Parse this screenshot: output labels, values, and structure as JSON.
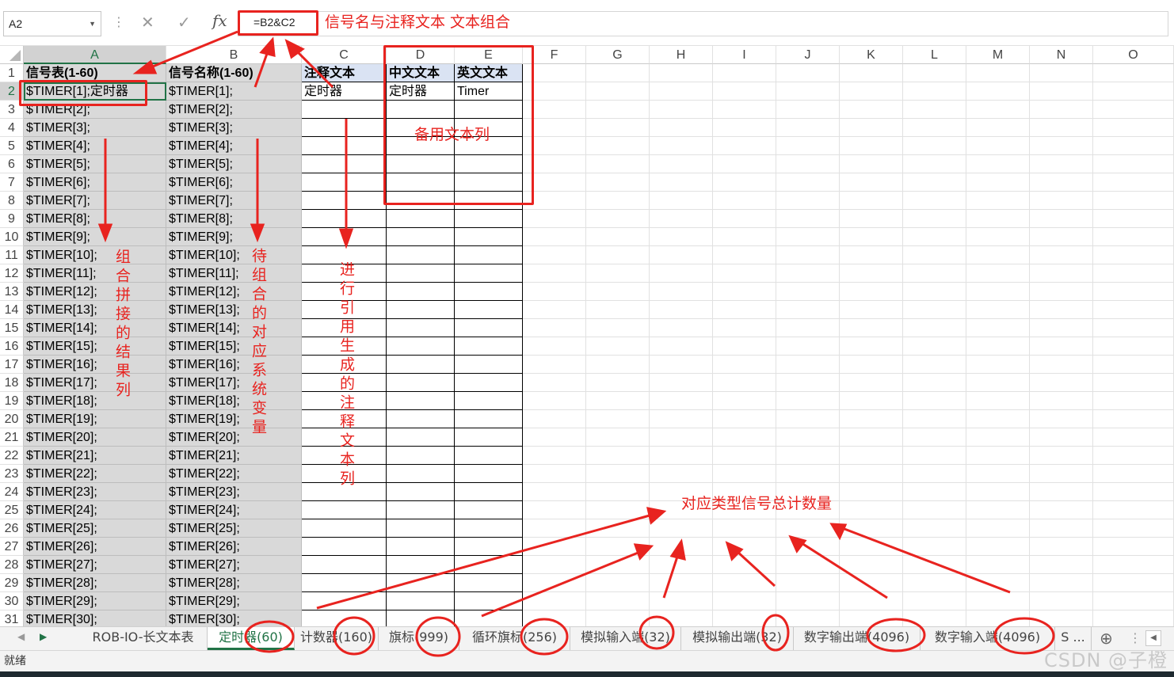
{
  "formula_bar": {
    "name_box": "A2",
    "cancel_glyph": "✕",
    "enter_glyph": "✓",
    "fx_label": "fx",
    "formula": "=B2&C2"
  },
  "columns": [
    "A",
    "B",
    "C",
    "D",
    "E",
    "F",
    "G",
    "H",
    "I",
    "J",
    "K",
    "L",
    "M",
    "N",
    "O"
  ],
  "selected_cell": "A2",
  "headers": {
    "A": "信号表(1-60)",
    "B": "信号名称(1-60)",
    "C": "注释文本",
    "D": "中文文本",
    "E": "英文文本"
  },
  "row2": {
    "A": "$TIMER[1];定时器",
    "B": "$TIMER[1];",
    "C": "定时器",
    "D": "定时器",
    "E": "Timer"
  },
  "col_a_rows": [
    "$TIMER[2];",
    "$TIMER[3];",
    "$TIMER[4];",
    "$TIMER[5];",
    "$TIMER[6];",
    "$TIMER[7];",
    "$TIMER[8];",
    "$TIMER[9];",
    "$TIMER[10];",
    "$TIMER[11];",
    "$TIMER[12];",
    "$TIMER[13];",
    "$TIMER[14];",
    "$TIMER[15];",
    "$TIMER[16];",
    "$TIMER[17];",
    "$TIMER[18];",
    "$TIMER[19];",
    "$TIMER[20];",
    "$TIMER[21];",
    "$TIMER[22];",
    "$TIMER[23];",
    "$TIMER[24];",
    "$TIMER[25];",
    "$TIMER[26];",
    "$TIMER[27];",
    "$TIMER[28];",
    "$TIMER[29];",
    "$TIMER[30];"
  ],
  "col_b_rows": [
    "$TIMER[2];",
    "$TIMER[3];",
    "$TIMER[4];",
    "$TIMER[5];",
    "$TIMER[6];",
    "$TIMER[7];",
    "$TIMER[8];",
    "$TIMER[9];",
    "$TIMER[10];",
    "$TIMER[11];",
    "$TIMER[12];",
    "$TIMER[13];",
    "$TIMER[14];",
    "$TIMER[15];",
    "$TIMER[16];",
    "$TIMER[17];",
    "$TIMER[18];",
    "$TIMER[19];",
    "$TIMER[20];",
    "$TIMER[21];",
    "$TIMER[22];",
    "$TIMER[23];",
    "$TIMER[24];",
    "$TIMER[25];",
    "$TIMER[26];",
    "$TIMER[27];",
    "$TIMER[28];",
    "$TIMER[29];",
    "$TIMER[30];"
  ],
  "row_numbers": [
    "1",
    "2",
    "3",
    "4",
    "5",
    "6",
    "7",
    "8",
    "9",
    "10",
    "11",
    "12",
    "13",
    "14",
    "15",
    "16",
    "17",
    "18",
    "19",
    "20",
    "21",
    "22",
    "23",
    "24",
    "25",
    "26",
    "27",
    "28",
    "29",
    "30",
    "31"
  ],
  "annotations": {
    "formula_note": "信号名与注释文本 文本组合",
    "spare_cols": "备用文本列",
    "col_a_note": "组合拼接的结果列",
    "col_b_note": "待组合的对应系统变量",
    "col_c_note": "进行引用生成的注释文本列",
    "count_note": "对应类型信号总计数量"
  },
  "sheet_tabs": [
    "ROB-IO-长文本表",
    "定时器(60)",
    "计数器(160)",
    "旗标(999)",
    "循环旗标(256)",
    "模拟输入端(32)",
    "模拟输出端(32)",
    "数字输出端(4096)",
    "数字输入端(4096)",
    "S ..."
  ],
  "active_tab": "定时器(60)",
  "tab_add_glyph": "⊕",
  "status_text": "就绪",
  "watermark": "CSDN @子橙",
  "colors": {
    "accent": "#217346",
    "annotation": "#e8231f",
    "grey_fill": "#d9d9d9",
    "header_fill": "#dae3f3"
  }
}
